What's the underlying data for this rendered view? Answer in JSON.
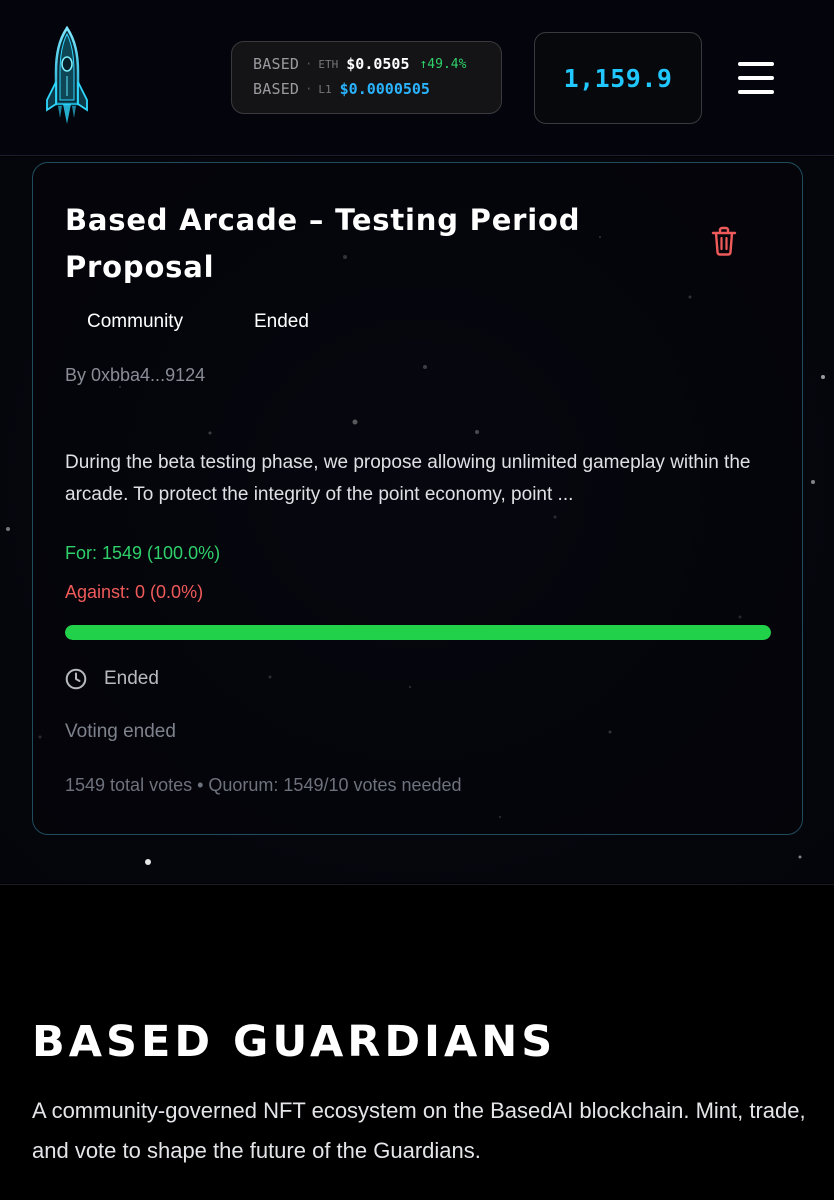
{
  "header": {
    "logo_icon": "rocket-icon",
    "ticker": {
      "rows": [
        {
          "token": "BASED",
          "chain": "ETH",
          "price": "$0.0505",
          "change": "↑49.4%"
        },
        {
          "token": "BASED",
          "chain": "L1",
          "price": "$0.0000505"
        }
      ],
      "separator": "·"
    },
    "balance": "1,159.9",
    "menu_icon": "hamburger-menu-icon"
  },
  "proposal": {
    "title": "Based Arcade – Testing Period Proposal",
    "delete_icon": "trash-icon",
    "tags": [
      "Community",
      "Ended"
    ],
    "author": "By 0xbba4...9124",
    "description": "During the beta testing phase, we propose allowing unlimited gameplay within the arcade. To protect the integrity of the point economy, point ...",
    "votes_for": "For: 1549 (100.0%)",
    "votes_against": "Against: 0 (0.0%)",
    "for_fraction": 1.0,
    "status_icon": "clock-icon",
    "status": "Ended",
    "voting_status": "Voting ended",
    "totals": "1549 total votes • Quorum: 1549/10 votes needed"
  },
  "colors": {
    "for": "#2fd06a",
    "against": "#f05a5a",
    "accent_blue": "#21c7ff",
    "card_border": "#1f4d5e"
  },
  "footer": {
    "title": "BASED GUARDIANS",
    "description": "A community-governed NFT ecosystem on the BasedAI blockchain. Mint, trade, and vote to shape the future of the Guardians."
  }
}
